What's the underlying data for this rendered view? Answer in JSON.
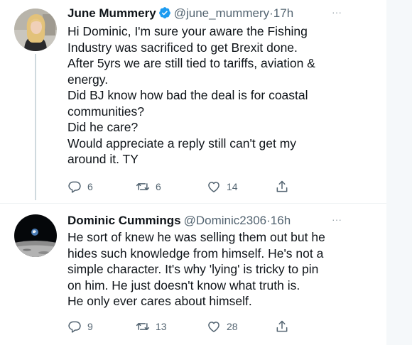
{
  "tweets": [
    {
      "author": {
        "name": "June Mummery",
        "handle": "@june_mummery",
        "verified": true,
        "avatar_icon": "profile-photo-blonde-woman"
      },
      "separator": "·",
      "time": "17h",
      "more_label": "···",
      "lines": [
        "Hi Dominic, I'm sure your aware the Fishing",
        "Industry was sacrificed to get Brexit done.",
        "After 5yrs we are still tied to tariffs, aviation &",
        "energy.",
        "Did BJ know how bad the deal is for coastal",
        "communities?",
        "Did he care?",
        "Would appreciate a reply still can't get my",
        "around it. TY"
      ],
      "stats": {
        "replies": "6",
        "retweets": "6",
        "likes": "14"
      }
    },
    {
      "author": {
        "name": "Dominic Cummings",
        "handle": "@Dominic2306",
        "verified": false,
        "avatar_icon": "profile-photo-earth-from-moon"
      },
      "separator": "·",
      "time": "16h",
      "more_label": "···",
      "lines": [
        "He sort of knew he was selling them out but he",
        "hides such knowledge from himself. He's not a",
        "simple character. It's why 'lying' is tricky to pin",
        "on him. He just doesn't know what truth is.",
        "He only ever cares about himself."
      ],
      "stats": {
        "replies": "9",
        "retweets": "13",
        "likes": "28"
      }
    }
  ],
  "colors": {
    "text_primary": "#0f1419",
    "text_secondary": "#536471",
    "verified_blue": "#1d9bf0",
    "thread_line": "#cfd9de",
    "gutter": "#f5f8fa"
  },
  "icons": {
    "reply": "reply-icon",
    "retweet": "retweet-icon",
    "like": "heart-icon",
    "share": "share-icon",
    "verified": "verified-badge-icon"
  }
}
